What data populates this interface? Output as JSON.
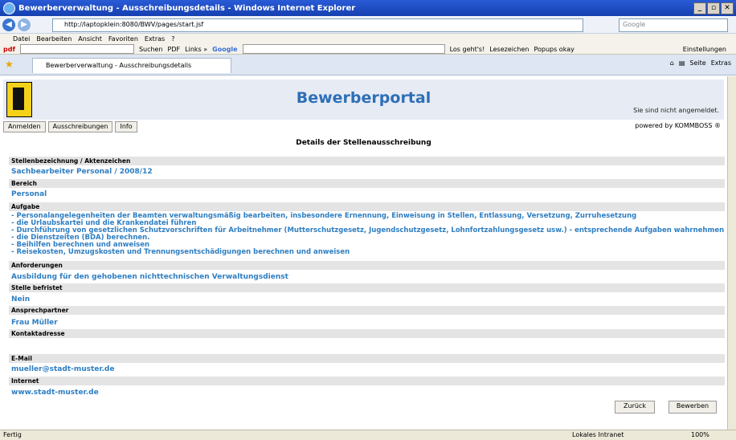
{
  "window": {
    "title": "Bewerberverwaltung - Ausschreibungsdetails - Windows Internet Explorer"
  },
  "address": {
    "url": "http://laptopklein:8080/BWV/pages/start.jsf",
    "search_placeholder": "Google"
  },
  "menu": [
    "Datei",
    "Bearbeiten",
    "Ansicht",
    "Favoriten",
    "Extras",
    "?"
  ],
  "toolbar": {
    "suchen": "Suchen",
    "pdf": "PDF",
    "links": "Links »",
    "google": "Google",
    "losgehts": "Los geht's!",
    "lesezeichen": "Lesezeichen",
    "popups": "Popups okay",
    "einstellungen": "Einstellungen"
  },
  "tab": {
    "label": "Bewerberverwaltung - Ausschreibungsdetails",
    "seite": "Seite",
    "extras": "Extras"
  },
  "portal": {
    "title": "Bewerberportal",
    "login_status": "Sie sind nicht angemeldet.",
    "powered": "powered by KOMMBOSS ®"
  },
  "nav": [
    "Anmelden",
    "Ausschreibungen",
    "Info"
  ],
  "page_title": "Details der Stellenausschreibung",
  "fields": {
    "stelle_label": "Stellenbezeichnung / Aktenzeichen",
    "stelle_value": "Sachbearbeiter Personal / 2008/12",
    "bereich_label": "Bereich",
    "bereich_value": "Personal",
    "aufgabe_label": "Aufgabe",
    "aufgabe_lines": [
      "- Personalangelegenheiten der Beamten verwaltungsmäßig bearbeiten, insbesondere Ernennung, Einweisung in Stellen, Entlassung, Versetzung, Zurruhesetzung",
      "- die Urlaubskartei und die Krankendatei führen",
      "- Durchführung von gesetzlichen Schutzvorschriften für Arbeitnehmer (Mutterschutzgesetz, Jugendschutzgesetz, Lohnfortzahlungsgesetz usw.) - entsprechende Aufgaben wahrnehmen",
      "- die Dienstzeiten (BDA) berechnen.",
      "- Beihilfen berechnen und anweisen",
      "- Reisekosten, Umzugskosten und Trennungsentschädigungen berechnen und anweisen"
    ],
    "anforderungen_label": "Anforderungen",
    "anforderungen_value": "Ausbildung für den gehobenen nichttechnischen Verwaltungsdienst",
    "befristet_label": "Stelle befristet",
    "befristet_value": "Nein",
    "ansprech_label": "Ansprechpartner",
    "ansprech_value": "Frau Müller",
    "kontakt_label": "Kontaktadresse",
    "email_label": "E-Mail",
    "email_value": "mueller@stadt-muster.de",
    "internet_label": "Internet",
    "internet_value": "www.stadt-muster.de"
  },
  "buttons": {
    "back": "Zurück",
    "apply": "Bewerben"
  },
  "status": {
    "left": "Fertig",
    "zone": "Lokales Intranet",
    "zoom": "100%"
  }
}
